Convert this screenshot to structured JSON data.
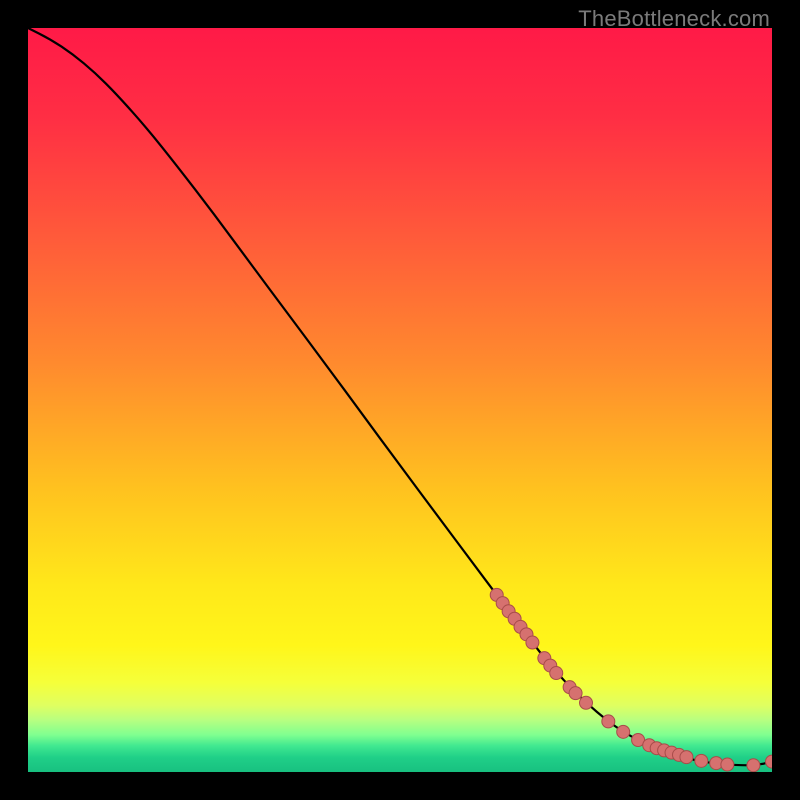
{
  "watermark": "TheBottleneck.com",
  "colors": {
    "gradient_stops": [
      {
        "offset": 0.0,
        "color": "#ff1a47"
      },
      {
        "offset": 0.12,
        "color": "#ff2e44"
      },
      {
        "offset": 0.28,
        "color": "#ff5a3a"
      },
      {
        "offset": 0.45,
        "color": "#ff8a2e"
      },
      {
        "offset": 0.62,
        "color": "#ffc21f"
      },
      {
        "offset": 0.75,
        "color": "#ffe81a"
      },
      {
        "offset": 0.83,
        "color": "#fff61a"
      },
      {
        "offset": 0.88,
        "color": "#f5ff3a"
      },
      {
        "offset": 0.91,
        "color": "#e0ff60"
      },
      {
        "offset": 0.93,
        "color": "#b8ff80"
      },
      {
        "offset": 0.95,
        "color": "#80ff90"
      },
      {
        "offset": 0.965,
        "color": "#40e890"
      },
      {
        "offset": 0.98,
        "color": "#20d088"
      },
      {
        "offset": 1.0,
        "color": "#18c080"
      }
    ],
    "curve": "#000000",
    "marker_fill": "#d6716f",
    "marker_stroke": "#a84c4a"
  },
  "chart_data": {
    "type": "line",
    "title": "",
    "xlabel": "",
    "ylabel": "",
    "xlim": [
      0,
      100
    ],
    "ylim": [
      0,
      100
    ],
    "grid": false,
    "series": [
      {
        "name": "bottleneck-curve",
        "x": [
          0,
          3,
          6,
          9,
          12,
          16,
          20,
          25,
          30,
          35,
          40,
          45,
          50,
          55,
          60,
          63,
          66,
          69,
          72,
          75,
          78,
          80,
          82,
          84,
          86,
          88,
          90,
          92,
          94,
          96,
          98,
          100
        ],
        "y": [
          100,
          98.5,
          96.5,
          94,
          91,
          86.5,
          81.5,
          75,
          68.2,
          61.5,
          54.8,
          48,
          41.2,
          34.5,
          27.8,
          23.8,
          19.8,
          15.8,
          12.3,
          9.3,
          6.8,
          5.4,
          4.3,
          3.4,
          2.6,
          2.0,
          1.5,
          1.2,
          1.0,
          0.9,
          0.9,
          1.4
        ]
      }
    ],
    "markers": {
      "name": "highlighted-points",
      "x": [
        63.0,
        63.8,
        64.6,
        65.4,
        66.2,
        67.0,
        67.8,
        69.4,
        70.2,
        71.0,
        72.8,
        73.6,
        75.0,
        78.0,
        80.0,
        82.0,
        83.5,
        84.5,
        85.5,
        86.5,
        87.5,
        88.5,
        90.5,
        92.5,
        94.0,
        97.5,
        100.0
      ],
      "y": [
        23.8,
        22.7,
        21.6,
        20.6,
        19.5,
        18.5,
        17.4,
        15.3,
        14.3,
        13.3,
        11.4,
        10.6,
        9.3,
        6.8,
        5.4,
        4.3,
        3.6,
        3.2,
        2.9,
        2.6,
        2.3,
        2.0,
        1.5,
        1.2,
        1.0,
        0.9,
        1.4
      ]
    }
  }
}
